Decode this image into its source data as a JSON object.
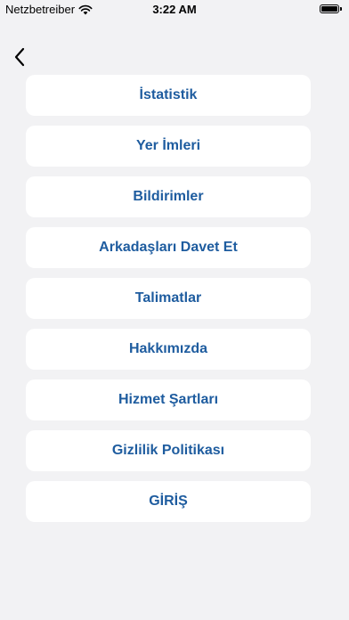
{
  "status_bar": {
    "carrier": "Netzbetreiber",
    "time": "3:22 AM"
  },
  "nav": {
    "back_icon": "chevron-left-icon"
  },
  "menu": {
    "accent_color": "#1e5c9f",
    "items": [
      {
        "label": "İstatistik"
      },
      {
        "label": "Yer İmleri"
      },
      {
        "label": "Bildirimler"
      },
      {
        "label": "Arkadaşları Davet Et"
      },
      {
        "label": "Talimatlar"
      },
      {
        "label": "Hakkımızda"
      },
      {
        "label": "Hizmet Şartları"
      },
      {
        "label": "Gizlilik Politikası"
      },
      {
        "label": "GİRİŞ"
      }
    ]
  }
}
